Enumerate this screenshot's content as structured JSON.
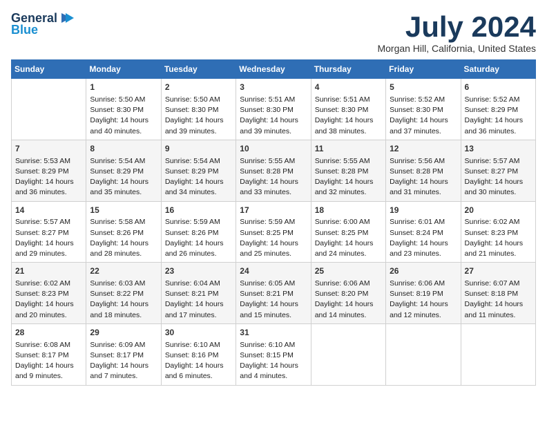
{
  "logo": {
    "general": "General",
    "blue": "Blue"
  },
  "title": "July 2024",
  "location": "Morgan Hill, California, United States",
  "days_header": [
    "Sunday",
    "Monday",
    "Tuesday",
    "Wednesday",
    "Thursday",
    "Friday",
    "Saturday"
  ],
  "weeks": [
    [
      {
        "day": "",
        "info": ""
      },
      {
        "day": "1",
        "info": "Sunrise: 5:50 AM\nSunset: 8:30 PM\nDaylight: 14 hours\nand 40 minutes."
      },
      {
        "day": "2",
        "info": "Sunrise: 5:50 AM\nSunset: 8:30 PM\nDaylight: 14 hours\nand 39 minutes."
      },
      {
        "day": "3",
        "info": "Sunrise: 5:51 AM\nSunset: 8:30 PM\nDaylight: 14 hours\nand 39 minutes."
      },
      {
        "day": "4",
        "info": "Sunrise: 5:51 AM\nSunset: 8:30 PM\nDaylight: 14 hours\nand 38 minutes."
      },
      {
        "day": "5",
        "info": "Sunrise: 5:52 AM\nSunset: 8:30 PM\nDaylight: 14 hours\nand 37 minutes."
      },
      {
        "day": "6",
        "info": "Sunrise: 5:52 AM\nSunset: 8:29 PM\nDaylight: 14 hours\nand 36 minutes."
      }
    ],
    [
      {
        "day": "7",
        "info": "Sunrise: 5:53 AM\nSunset: 8:29 PM\nDaylight: 14 hours\nand 36 minutes."
      },
      {
        "day": "8",
        "info": "Sunrise: 5:54 AM\nSunset: 8:29 PM\nDaylight: 14 hours\nand 35 minutes."
      },
      {
        "day": "9",
        "info": "Sunrise: 5:54 AM\nSunset: 8:29 PM\nDaylight: 14 hours\nand 34 minutes."
      },
      {
        "day": "10",
        "info": "Sunrise: 5:55 AM\nSunset: 8:28 PM\nDaylight: 14 hours\nand 33 minutes."
      },
      {
        "day": "11",
        "info": "Sunrise: 5:55 AM\nSunset: 8:28 PM\nDaylight: 14 hours\nand 32 minutes."
      },
      {
        "day": "12",
        "info": "Sunrise: 5:56 AM\nSunset: 8:28 PM\nDaylight: 14 hours\nand 31 minutes."
      },
      {
        "day": "13",
        "info": "Sunrise: 5:57 AM\nSunset: 8:27 PM\nDaylight: 14 hours\nand 30 minutes."
      }
    ],
    [
      {
        "day": "14",
        "info": "Sunrise: 5:57 AM\nSunset: 8:27 PM\nDaylight: 14 hours\nand 29 minutes."
      },
      {
        "day": "15",
        "info": "Sunrise: 5:58 AM\nSunset: 8:26 PM\nDaylight: 14 hours\nand 28 minutes."
      },
      {
        "day": "16",
        "info": "Sunrise: 5:59 AM\nSunset: 8:26 PM\nDaylight: 14 hours\nand 26 minutes."
      },
      {
        "day": "17",
        "info": "Sunrise: 5:59 AM\nSunset: 8:25 PM\nDaylight: 14 hours\nand 25 minutes."
      },
      {
        "day": "18",
        "info": "Sunrise: 6:00 AM\nSunset: 8:25 PM\nDaylight: 14 hours\nand 24 minutes."
      },
      {
        "day": "19",
        "info": "Sunrise: 6:01 AM\nSunset: 8:24 PM\nDaylight: 14 hours\nand 23 minutes."
      },
      {
        "day": "20",
        "info": "Sunrise: 6:02 AM\nSunset: 8:23 PM\nDaylight: 14 hours\nand 21 minutes."
      }
    ],
    [
      {
        "day": "21",
        "info": "Sunrise: 6:02 AM\nSunset: 8:23 PM\nDaylight: 14 hours\nand 20 minutes."
      },
      {
        "day": "22",
        "info": "Sunrise: 6:03 AM\nSunset: 8:22 PM\nDaylight: 14 hours\nand 18 minutes."
      },
      {
        "day": "23",
        "info": "Sunrise: 6:04 AM\nSunset: 8:21 PM\nDaylight: 14 hours\nand 17 minutes."
      },
      {
        "day": "24",
        "info": "Sunrise: 6:05 AM\nSunset: 8:21 PM\nDaylight: 14 hours\nand 15 minutes."
      },
      {
        "day": "25",
        "info": "Sunrise: 6:06 AM\nSunset: 8:20 PM\nDaylight: 14 hours\nand 14 minutes."
      },
      {
        "day": "26",
        "info": "Sunrise: 6:06 AM\nSunset: 8:19 PM\nDaylight: 14 hours\nand 12 minutes."
      },
      {
        "day": "27",
        "info": "Sunrise: 6:07 AM\nSunset: 8:18 PM\nDaylight: 14 hours\nand 11 minutes."
      }
    ],
    [
      {
        "day": "28",
        "info": "Sunrise: 6:08 AM\nSunset: 8:17 PM\nDaylight: 14 hours\nand 9 minutes."
      },
      {
        "day": "29",
        "info": "Sunrise: 6:09 AM\nSunset: 8:17 PM\nDaylight: 14 hours\nand 7 minutes."
      },
      {
        "day": "30",
        "info": "Sunrise: 6:10 AM\nSunset: 8:16 PM\nDaylight: 14 hours\nand 6 minutes."
      },
      {
        "day": "31",
        "info": "Sunrise: 6:10 AM\nSunset: 8:15 PM\nDaylight: 14 hours\nand 4 minutes."
      },
      {
        "day": "",
        "info": ""
      },
      {
        "day": "",
        "info": ""
      },
      {
        "day": "",
        "info": ""
      }
    ]
  ]
}
